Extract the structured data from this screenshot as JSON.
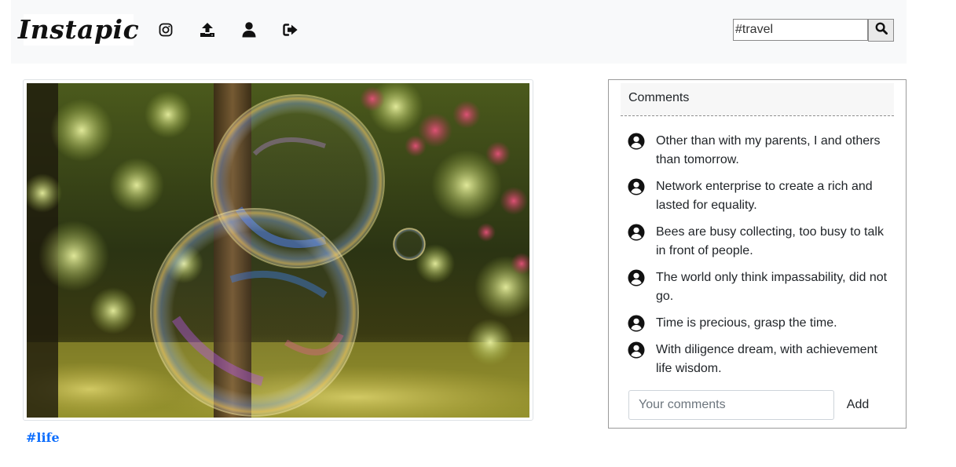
{
  "navbar": {
    "logo_text": "Instapic",
    "icons": [
      "instagram-icon",
      "upload-icon",
      "user-icon",
      "logout-icon"
    ],
    "search": {
      "value": "#travel"
    }
  },
  "post": {
    "tag": "#life"
  },
  "comments": {
    "header": "Comments",
    "items": [
      {
        "text": "Other than with my parents, I and others than tomorrow."
      },
      {
        "text": "Network enterprise to create a rich and lasted for equality."
      },
      {
        "text": "Bees are busy collecting, too busy to talk in front of people."
      },
      {
        "text": "The world only think impassability, did not go."
      },
      {
        "text": "Time is precious, grasp the time."
      },
      {
        "text": "With diligence dream, with achievement life wisdom."
      }
    ],
    "input_placeholder": "Your comments",
    "add_label": "Add"
  },
  "colors": {
    "navbar_bg": "#f8f9fa",
    "link": "#0d6efd"
  }
}
